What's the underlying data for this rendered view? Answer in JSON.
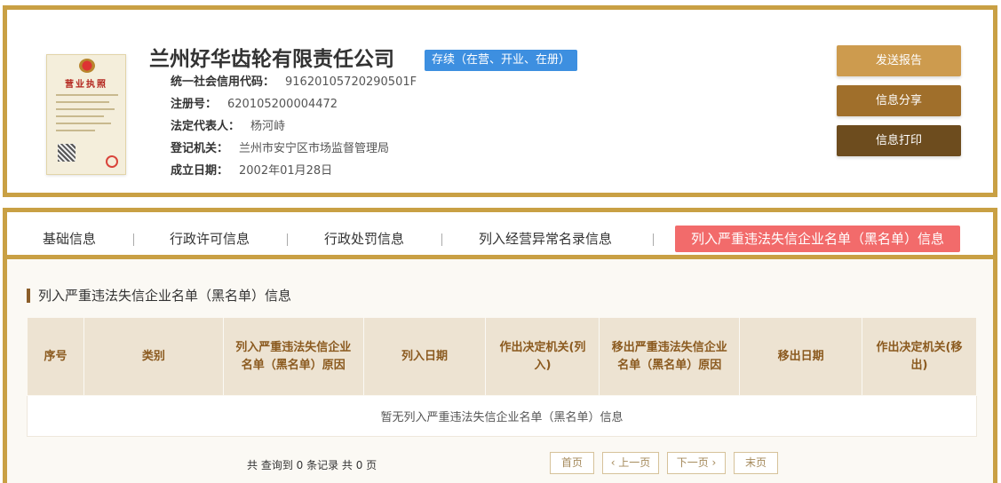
{
  "company": {
    "name": "兰州好华齿轮有限责任公司",
    "status": "存续（在营、开业、在册）",
    "license_title": "营业执照",
    "fields": [
      {
        "key": "统一社会信用代码：",
        "value": "91620105720290501F"
      },
      {
        "key": "注册号：",
        "value": "620105200004472"
      },
      {
        "key": "法定代表人：",
        "value": "杨河峙"
      },
      {
        "key": "登记机关：",
        "value": "兰州市安宁区市场监督管理局"
      },
      {
        "key": "成立日期：",
        "value": "2002年01月28日"
      }
    ]
  },
  "actions": {
    "send_report": "发送报告",
    "share_info": "信息分享",
    "print_info": "信息打印"
  },
  "tabs": [
    {
      "label": "基础信息"
    },
    {
      "label": "行政许可信息"
    },
    {
      "label": "行政处罚信息"
    },
    {
      "label": "列入经营异常名录信息"
    },
    {
      "label": "列入严重违法失信企业名单（黑名单）信息",
      "active": true
    }
  ],
  "section": {
    "title": "列入严重违法失信企业名单（黑名单）信息",
    "columns": [
      "序号",
      "类别",
      "列入严重违法失信企业名单（黑名单）原因",
      "列入日期",
      "作出决定机关(列入)",
      "移出严重违法失信企业名单（黑名单）原因",
      "移出日期",
      "作出决定机关(移出)"
    ],
    "empty_text": "暂无列入严重违法失信企业名单（黑名单）信息"
  },
  "pagination": {
    "summary": "共 查询到 0 条记录 共 0 页",
    "first": "首页",
    "prev": "‹ 上一页",
    "next": "下一页 ›",
    "last": "末页"
  },
  "colors": {
    "frame": "#c9a044",
    "badge": "#3d8fe0",
    "active_tab": "#f26b6b",
    "btn_send": "#cd9b4e",
    "btn_share": "#a06f2b",
    "btn_print": "#6d4c1e"
  }
}
